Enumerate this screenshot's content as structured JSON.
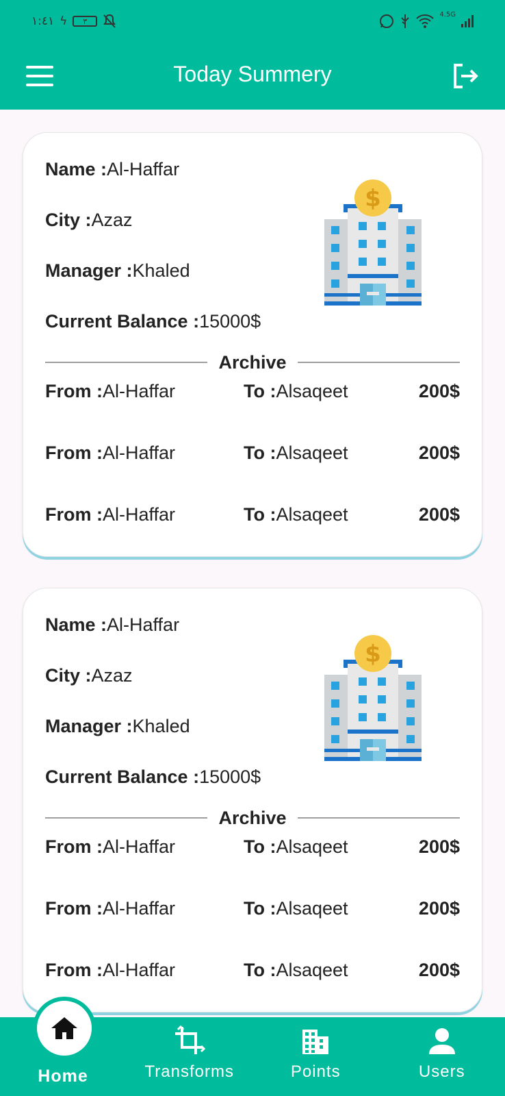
{
  "status_bar": {
    "time": "١:٤١",
    "battery": "٣",
    "network": "4.5G"
  },
  "header": {
    "title": "Today Summery"
  },
  "cards": [
    {
      "name_label": "Name :",
      "name": "Al-Haffar",
      "city_label": "City :",
      "city": "Azaz",
      "manager_label": "Manager :",
      "manager": "Khaled",
      "balance_label": "Current Balance :",
      "balance": "15000$",
      "archive_label": "Archive",
      "transfers": [
        {
          "from_label": "From :",
          "from": "Al-Haffar",
          "to_label": "To :",
          "to": "Alsaqeet",
          "amount": "200$"
        },
        {
          "from_label": "From :",
          "from": "Al-Haffar",
          "to_label": "To :",
          "to": "Alsaqeet",
          "amount": "200$"
        },
        {
          "from_label": "From :",
          "from": "Al-Haffar",
          "to_label": "To :",
          "to": "Alsaqeet",
          "amount": "200$"
        }
      ]
    },
    {
      "name_label": "Name :",
      "name": "Al-Haffar",
      "city_label": "City :",
      "city": "Azaz",
      "manager_label": "Manager :",
      "manager": "Khaled",
      "balance_label": "Current Balance :",
      "balance": "15000$",
      "archive_label": "Archive",
      "transfers": [
        {
          "from_label": "From :",
          "from": "Al-Haffar",
          "to_label": "To :",
          "to": "Alsaqeet",
          "amount": "200$"
        },
        {
          "from_label": "From :",
          "from": "Al-Haffar",
          "to_label": "To :",
          "to": "Alsaqeet",
          "amount": "200$"
        },
        {
          "from_label": "From :",
          "from": "Al-Haffar",
          "to_label": "To :",
          "to": "Alsaqeet",
          "amount": "200$"
        }
      ]
    }
  ],
  "bottom_nav": {
    "items": [
      {
        "label": "Home",
        "icon": "home-icon",
        "active": true
      },
      {
        "label": "Transforms",
        "icon": "crop-icon"
      },
      {
        "label": "Points",
        "icon": "building-grid-icon"
      },
      {
        "label": "Users",
        "icon": "person-icon"
      }
    ]
  },
  "colors": {
    "primary": "#00bc9c",
    "card_shadow": "#8fd3e3",
    "background": "#fcf7fb"
  }
}
